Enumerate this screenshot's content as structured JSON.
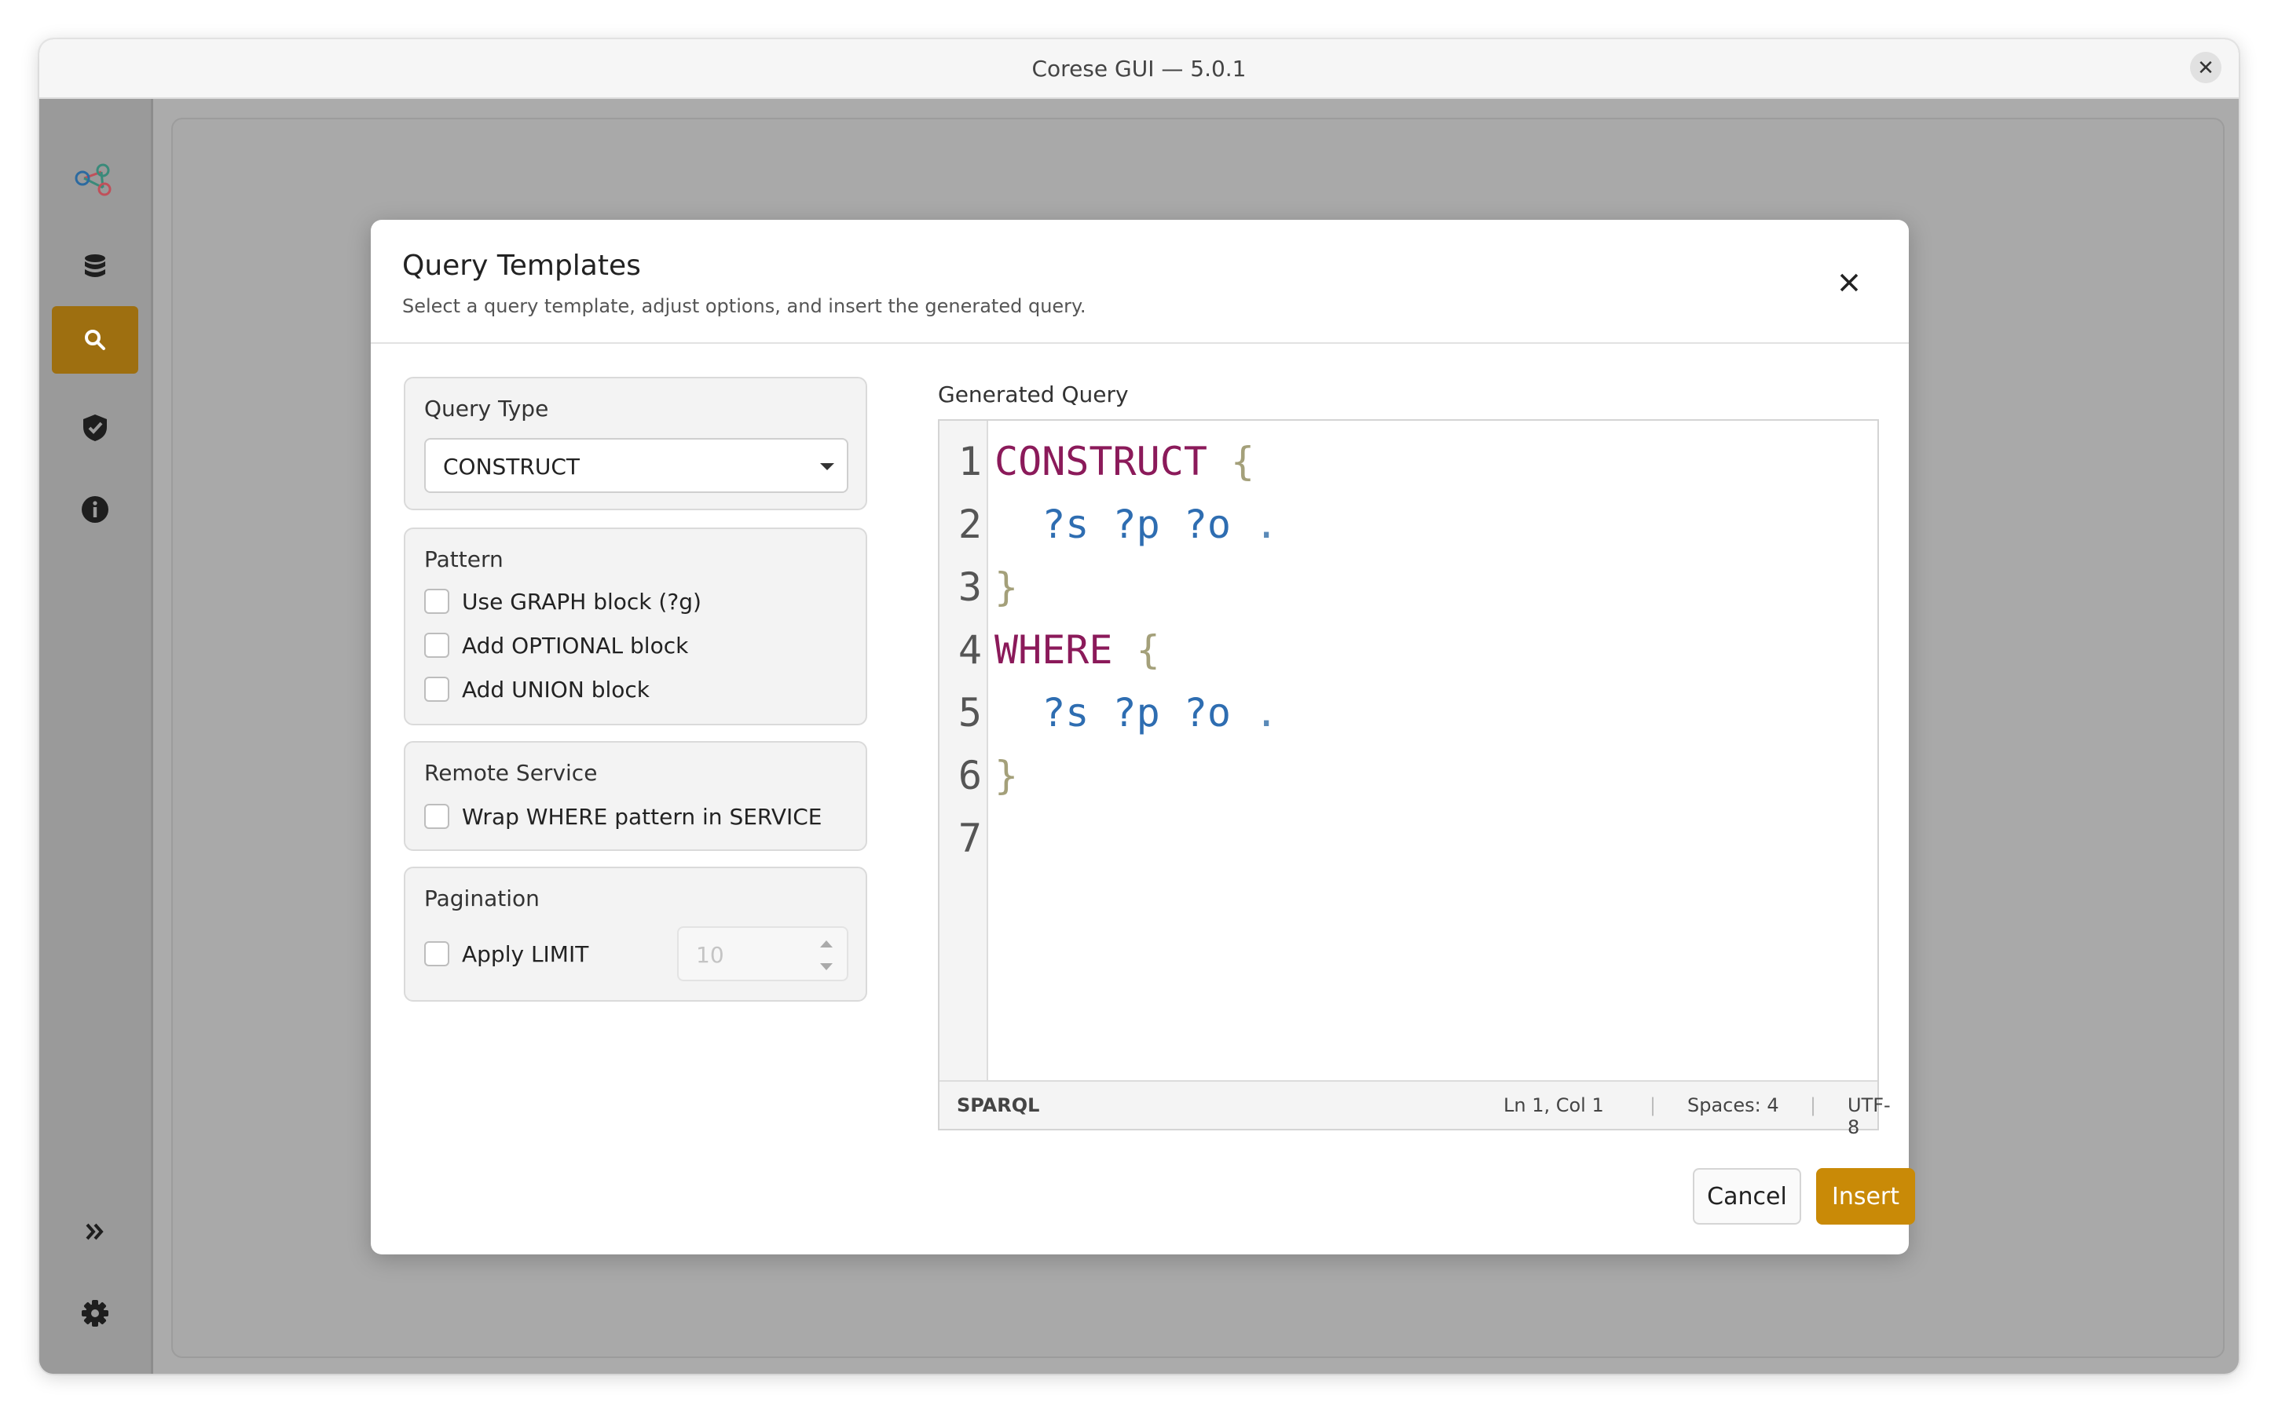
{
  "window": {
    "title": "Corese GUI — 5.0.1"
  },
  "sidebar": {
    "items": [
      {
        "name": "graph",
        "icon": "graph-nodes-icon"
      },
      {
        "name": "data",
        "icon": "database-icon"
      },
      {
        "name": "query",
        "icon": "search-icon",
        "active": true
      },
      {
        "name": "validation",
        "icon": "shield-check-icon"
      },
      {
        "name": "info",
        "icon": "info-icon"
      }
    ],
    "bottom": [
      {
        "name": "expand",
        "icon": "chevrons-right-icon"
      },
      {
        "name": "settings",
        "icon": "gear-icon"
      }
    ],
    "accent_color": "#9e6f10"
  },
  "modal": {
    "title": "Query Templates",
    "subtitle": "Select a query template, adjust options, and insert the generated query.",
    "query_type": {
      "label": "Query Type",
      "value": "CONSTRUCT"
    },
    "pattern": {
      "label": "Pattern",
      "options": [
        {
          "label": "Use GRAPH block (?g)",
          "checked": false
        },
        {
          "label": "Add OPTIONAL block",
          "checked": false
        },
        {
          "label": "Add UNION block",
          "checked": false
        }
      ]
    },
    "remote_service": {
      "label": "Remote Service",
      "option": {
        "label": "Wrap WHERE pattern in SERVICE",
        "checked": false
      }
    },
    "pagination": {
      "label": "Pagination",
      "option": {
        "label": "Apply LIMIT",
        "checked": false
      },
      "limit_value": "10"
    },
    "generated": {
      "label": "Generated Query",
      "line_numbers": [
        "1",
        "2",
        "3",
        "4",
        "5",
        "6",
        "7"
      ],
      "lines": [
        [
          {
            "t": "CONSTRUCT",
            "c": "kw"
          },
          {
            "t": " {",
            "c": "br"
          }
        ],
        [
          {
            "t": "  ?s ?p ?o",
            "c": "var"
          },
          {
            "t": " .",
            "c": "dot"
          }
        ],
        [
          {
            "t": "}",
            "c": "br"
          }
        ],
        [
          {
            "t": "WHERE",
            "c": "kw"
          },
          {
            "t": " {",
            "c": "br"
          }
        ],
        [
          {
            "t": "  ?s ?p ?o",
            "c": "var"
          },
          {
            "t": " .",
            "c": "dot"
          }
        ],
        [
          {
            "t": "}",
            "c": "br"
          }
        ],
        []
      ],
      "status": {
        "language": "SPARQL",
        "position": "Ln 1, Col 1",
        "spaces": "Spaces: 4",
        "encoding": "UTF-8"
      }
    },
    "buttons": {
      "cancel": "Cancel",
      "insert": "Insert"
    },
    "insert_color": "#c98a07"
  }
}
